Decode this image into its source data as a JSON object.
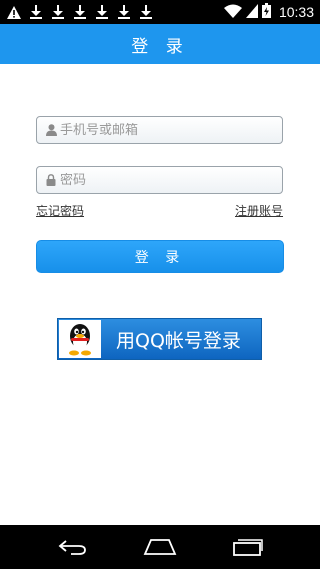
{
  "status_bar": {
    "time": "10:33",
    "left_icons": [
      "warning-icon",
      "download-icon",
      "download-icon",
      "download-icon",
      "download-icon",
      "download-icon",
      "download-icon"
    ],
    "right_icons": [
      "wifi-icon",
      "signal-icon",
      "battery-icon"
    ]
  },
  "header": {
    "title": "登 录"
  },
  "form": {
    "account_placeholder": "手机号或邮箱",
    "password_placeholder": "密码",
    "forgot_password": "忘记密码",
    "register_account": "注册账号",
    "login_button": "登 录"
  },
  "qq_login": {
    "label": "用QQ帐号登录"
  },
  "colors": {
    "accent": "#1e96ee",
    "qq_button": "#0e65c0"
  },
  "nav_bar": {
    "buttons": [
      "back-icon",
      "home-icon",
      "recents-icon"
    ]
  }
}
